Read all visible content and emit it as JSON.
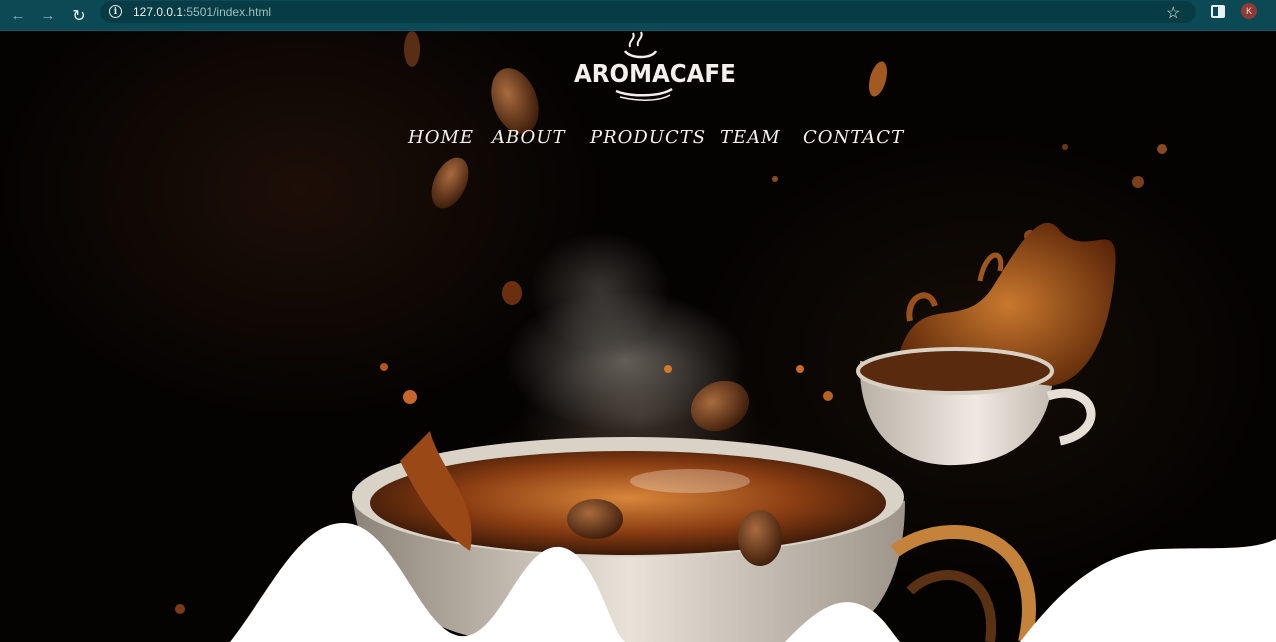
{
  "browser": {
    "url_host": "127.0.0.1",
    "url_rest": ":5501/index.html",
    "profile_initial": "K"
  },
  "site": {
    "logo_text": "AROMACAFE",
    "nav": [
      "HOME",
      "ABOUT",
      "PRODUCTS",
      "TEAM",
      "CONTACT"
    ]
  },
  "colors": {
    "browser_bar": "#0b4a55",
    "omnibox": "#073c45",
    "nav_text": "#f5f1ea",
    "wave_white": "#ffffff"
  }
}
